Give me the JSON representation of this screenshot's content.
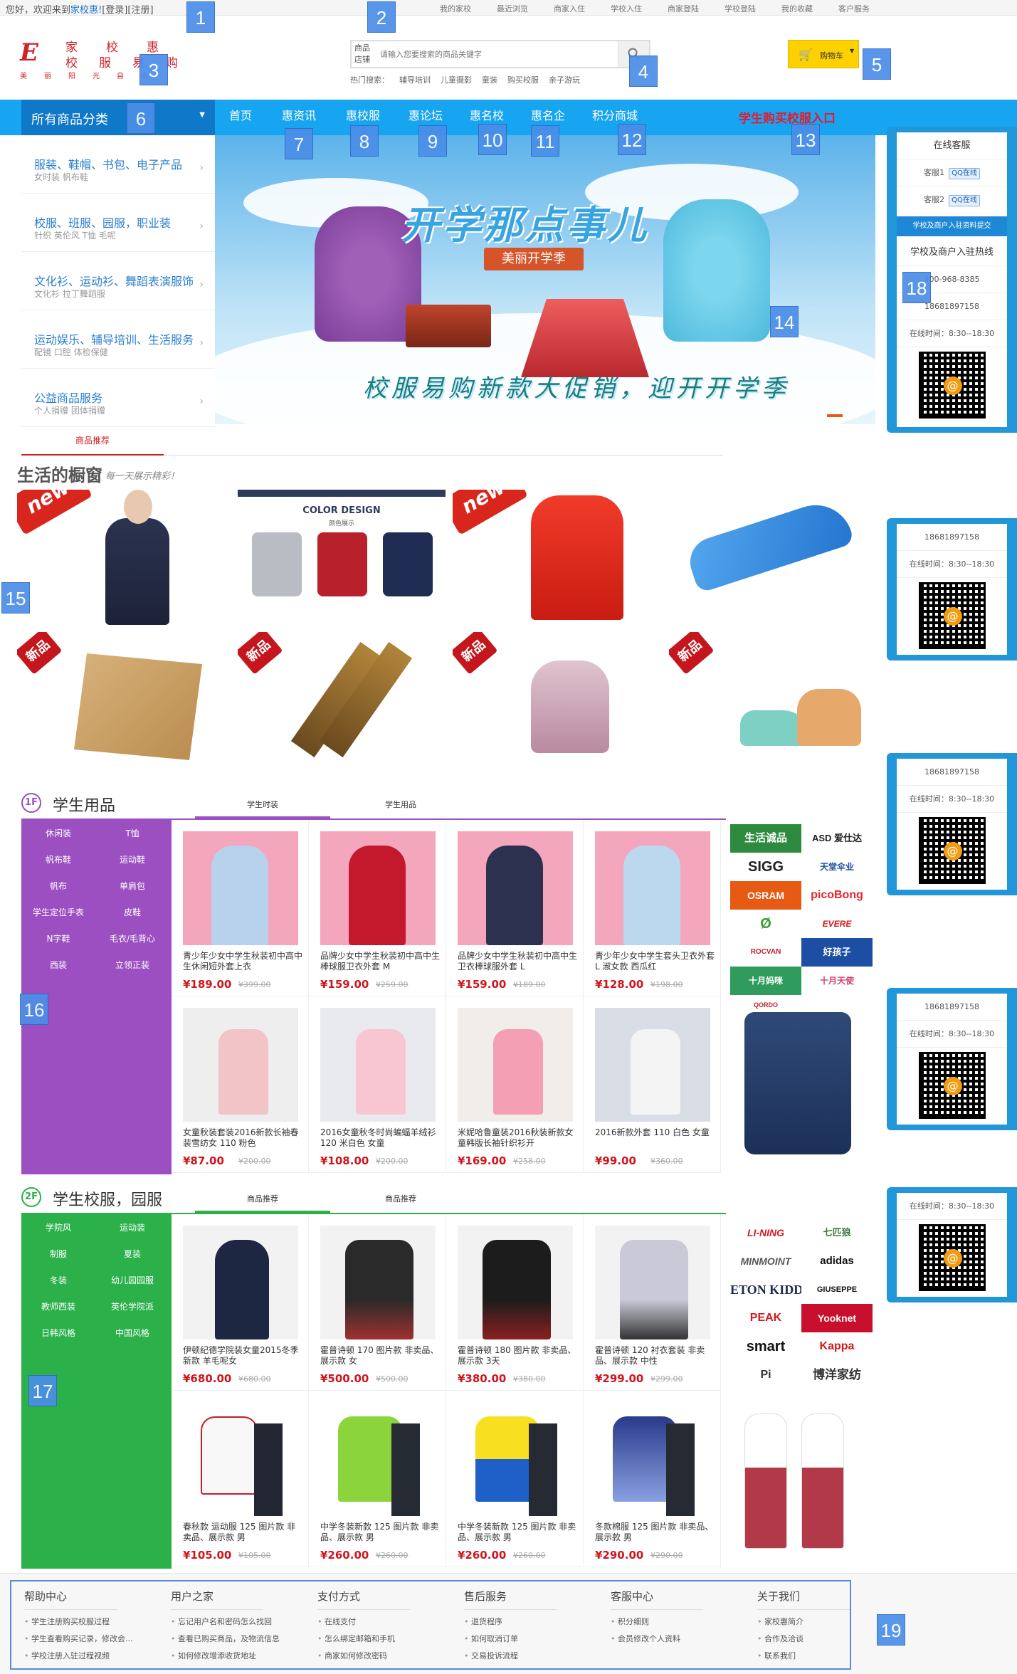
{
  "topbar": {
    "greeting": "您好，欢迎来到",
    "site": "家校惠!",
    "login": "[登录]",
    "register": "[注册]",
    "links": [
      "我的家校",
      "最近浏览",
      "商家入住",
      "学校入住",
      "商家登陆",
      "学校登陆",
      "我的收藏",
      "客户服务"
    ]
  },
  "logo": {
    "line1": "家校惠",
    "line2": "校服易购",
    "line3": "美丽阳光自由",
    "mark": "E"
  },
  "search": {
    "label": "商品店铺",
    "placeholder": "请输入您要搜索的商品关键字"
  },
  "hot": {
    "label": "热门搜索：",
    "items": [
      "辅导培训",
      "儿童摄影",
      "童装",
      "购买校服",
      "亲子游玩"
    ]
  },
  "cart": {
    "label": "购物车",
    "icon": "cart-icon"
  },
  "nav": {
    "all_categories": "所有商品分类",
    "items": [
      "首页",
      "惠资讯",
      "惠校服",
      "惠论坛",
      "惠名校",
      "惠名企",
      "积分商城"
    ],
    "promo": "学生购买校服入口"
  },
  "categories": [
    {
      "title": "服装、鞋帽、书包、电子产品",
      "sub": "女时装   帆布鞋"
    },
    {
      "title": "校服、班服、园服，职业装",
      "sub": "针织  英伦风  T恤  毛呢"
    },
    {
      "title": "文化衫、运动衫、舞蹈表演服饰",
      "sub": "文化衫  拉丁舞蹈服"
    },
    {
      "title": "运动娱乐、辅导培训、生活服务",
      "sub": "配镜  口腔  体检保健"
    },
    {
      "title": "公益商品服务",
      "sub": "个人捐赠  团体捐赠"
    }
  ],
  "banner": {
    "title": "开学那点事儿",
    "ribbon": "美丽开学季",
    "slogan": "校服易购新款大促销，迎开开学季"
  },
  "service": {
    "title": "在线客服",
    "agents": [
      "客服1",
      "客服2"
    ],
    "qq_label": "QQ在线",
    "submit": "学校及商户入驻资料提交",
    "hotline_title": "学校及商户入驻热线",
    "phone1": "400-968-8385",
    "phone2": "18681897158",
    "hours": "在线时间：8:30--18:30"
  },
  "showcase": {
    "tab": "商品推荐",
    "title": "生活的橱窗",
    "subtitle": "每一天展示精彩！",
    "tag_new": "new",
    "tag_xp": "新品",
    "vest_title": "COLOR DESIGN",
    "vest_sub": "颜色展示"
  },
  "floor1": {
    "num": "1F",
    "title": "学生用品",
    "tabs": [
      "学生时装",
      "学生用品"
    ],
    "tags": [
      "休闲装",
      "T恤",
      "帆布鞋",
      "运动鞋",
      "帆布",
      "单肩包",
      "学生定位手表",
      "皮鞋",
      "N字鞋",
      "毛衣/毛背心",
      "西装",
      "立领正装"
    ],
    "products": [
      {
        "name": "青少年少女中学生秋装初中高中生休闲短外套上衣",
        "price": "¥189.00",
        "old": "¥399.00"
      },
      {
        "name": "品牌少女中学生秋装初中高中生棒球服卫衣外套 M",
        "price": "¥159.00",
        "old": "¥259.00"
      },
      {
        "name": "品牌少女中学生秋装初中高中生卫衣棒球服外套 L",
        "price": "¥159.00",
        "old": "¥189.00"
      },
      {
        "name": "青少年少女中学生套头卫衣外套 L 淑女款 西瓜红",
        "price": "¥128.00",
        "old": "¥198.00"
      },
      {
        "name": "女童秋装套装2016新款长袖春装雪纺女 110 粉色",
        "price": "¥87.00",
        "old": "¥200.00"
      },
      {
        "name": "2016女童秋冬时尚蝙蝠羊绒衫 120 米白色 女童",
        "price": "¥108.00",
        "old": "¥200.00"
      },
      {
        "name": "米妮哈鲁童装2016秋装新款女童韩版长袖针织衫开",
        "price": "¥169.00",
        "old": "¥258.00"
      },
      {
        "name": "2016新款外套 110 白色 女童",
        "price": "¥99.00",
        "old": "¥360.00"
      }
    ],
    "brands": [
      "生活诚品",
      "ASD 爱仕达",
      "SIGG",
      "天堂伞业",
      "OSRAM",
      "picoBong",
      "Ø",
      "EVERE",
      "ROCVAN",
      "好孩子",
      "十月妈咪",
      "十月天使",
      "QORDO"
    ]
  },
  "floor2": {
    "num": "2F",
    "title": "学生校服，园服",
    "tabs": [
      "商品推荐",
      "商品推荐"
    ],
    "tags": [
      "学院风",
      "运动装",
      "制服",
      "夏装",
      "冬装",
      "幼儿园园服",
      "教师西装",
      "英伦学院派",
      "日韩风格",
      "中国风格"
    ],
    "products": [
      {
        "name": "伊顿纪德学院装女童2015冬季新款 羊毛呢女",
        "price": "¥680.00",
        "old": "¥680.00"
      },
      {
        "name": "霍普诗顿 170 图片款 非卖品、展示款 女",
        "price": "¥500.00",
        "old": "¥500.00"
      },
      {
        "name": "霍普诗顿 180 图片款 非卖品、展示款 3天",
        "price": "¥380.00",
        "old": "¥380.00"
      },
      {
        "name": "霍普诗顿 120 衬衣套装 非卖品、展示款 中性",
        "price": "¥299.00",
        "old": "¥299.00"
      },
      {
        "name": "春秋款 运动服 125 图片款 非卖品、展示款 男",
        "price": "¥105.00",
        "old": "¥105.00"
      },
      {
        "name": "中学冬装新款 125 图片款 非卖品、展示款 男",
        "price": "¥260.00",
        "old": "¥260.00"
      },
      {
        "name": "中学冬装新款 125 图片款 非卖品、展示款 男",
        "price": "¥260.00",
        "old": "¥260.00"
      },
      {
        "name": "冬款棉服 125 图片款 非卖品、展示款 男",
        "price": "¥290.00",
        "old": "¥290.00"
      }
    ],
    "brands": [
      "LI-NING",
      "七匹狼",
      "MINMOINT",
      "adidas",
      "ETON KIDD",
      "GIUSEPPE",
      "PEAK",
      "Yooknet",
      "smart",
      "Kappa",
      "Pi",
      "博洋家纺"
    ]
  },
  "footer": [
    {
      "title": "帮助中心",
      "items": [
        "学生注册购买校服过程",
        "学生查看购买记录，修改会...",
        "学校注册入驻过程视频"
      ]
    },
    {
      "title": "用户之家",
      "items": [
        "忘记用户名和密码怎么找回",
        "查看已购买商品，及物流信息",
        "如何修改增添收货地址"
      ]
    },
    {
      "title": "支付方式",
      "items": [
        "在线支付",
        "怎么绑定邮箱和手机",
        "商家如何修改密码"
      ]
    },
    {
      "title": "售后服务",
      "items": [
        "退货程序",
        "如何取消订单",
        "交易投诉流程"
      ]
    },
    {
      "title": "客服中心",
      "items": [
        "积分细则",
        "会员修改个人资料"
      ]
    },
    {
      "title": "关于我们",
      "items": [
        "家校惠简介",
        "合作及洽谈",
        "联系我们"
      ]
    }
  ],
  "badges": [
    "1",
    "2",
    "3",
    "4",
    "5",
    "6",
    "7",
    "8",
    "9",
    "10",
    "11",
    "12",
    "13",
    "14",
    "15",
    "16",
    "17",
    "18",
    "19"
  ],
  "colors": {
    "nav": "#17a5f2",
    "navDark": "#0f78c8",
    "floor1": "#9b4fc0",
    "floor2": "#2bb04a",
    "price": "#d0151e",
    "promo": "#e8192c",
    "service": "#2196d8"
  }
}
